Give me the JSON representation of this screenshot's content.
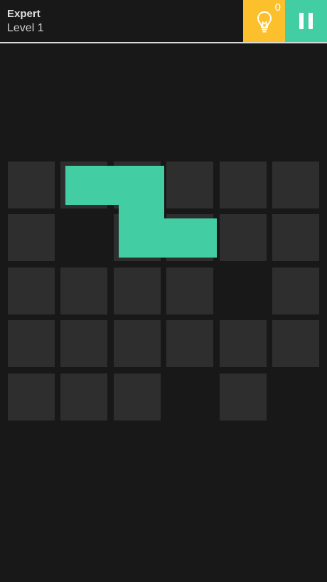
{
  "header": {
    "difficulty": "Expert",
    "level": "Level 1"
  },
  "hint": {
    "count": "0",
    "icon": "lightbulb-icon",
    "color": "#fcc02c"
  },
  "pause": {
    "icon": "pause-icon",
    "color": "#43cda3"
  },
  "board": {
    "cell_color": "#2e2e2e",
    "piece_color": "#43cda3",
    "rows": [
      [
        1,
        1,
        1,
        1,
        1,
        1
      ],
      [
        1,
        0,
        1,
        1,
        1,
        1
      ],
      [
        1,
        1,
        1,
        1,
        0,
        1
      ],
      [
        1,
        1,
        1,
        1,
        1,
        1
      ],
      [
        1,
        1,
        1,
        0,
        1,
        0
      ]
    ],
    "piece_cells": [
      [
        0,
        1
      ],
      [
        0,
        2
      ],
      [
        1,
        2
      ],
      [
        1,
        3
      ]
    ]
  }
}
